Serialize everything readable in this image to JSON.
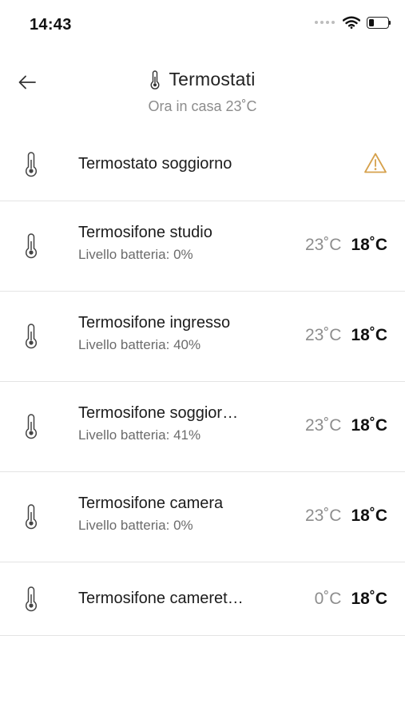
{
  "status_bar": {
    "time": "14:43",
    "icons": [
      "signal-dots-icon",
      "wifi-icon",
      "battery-icon"
    ],
    "battery_level": 0.3
  },
  "header": {
    "back_icon": "arrow-left-icon",
    "title_icon": "thermometer-icon",
    "title": "Termostati",
    "subtitle": "Ora in casa 23˚C"
  },
  "colors": {
    "warning": "#d6a14c",
    "divider": "#e4e4e4",
    "muted_text": "#8d8d8d"
  },
  "thermostats": [
    {
      "name": "Termostato soggiorno",
      "status_icon": "warning-triangle-icon"
    },
    {
      "name": "Termosifone studio",
      "battery": "Livello batteria: 0%",
      "current": "23˚C",
      "target": "18˚C"
    },
    {
      "name": "Termosifone ingresso",
      "battery": "Livello batteria: 40%",
      "current": "23˚C",
      "target": "18˚C"
    },
    {
      "name": "Termosifone soggior…",
      "battery": "Livello batteria: 41%",
      "current": "23˚C",
      "target": "18˚C"
    },
    {
      "name": "Termosifone camera",
      "battery": "Livello batteria: 0%",
      "current": "23˚C",
      "target": "18˚C"
    },
    {
      "name": "Termosifone cameret…",
      "current": "0˚C",
      "target": "18˚C"
    }
  ]
}
